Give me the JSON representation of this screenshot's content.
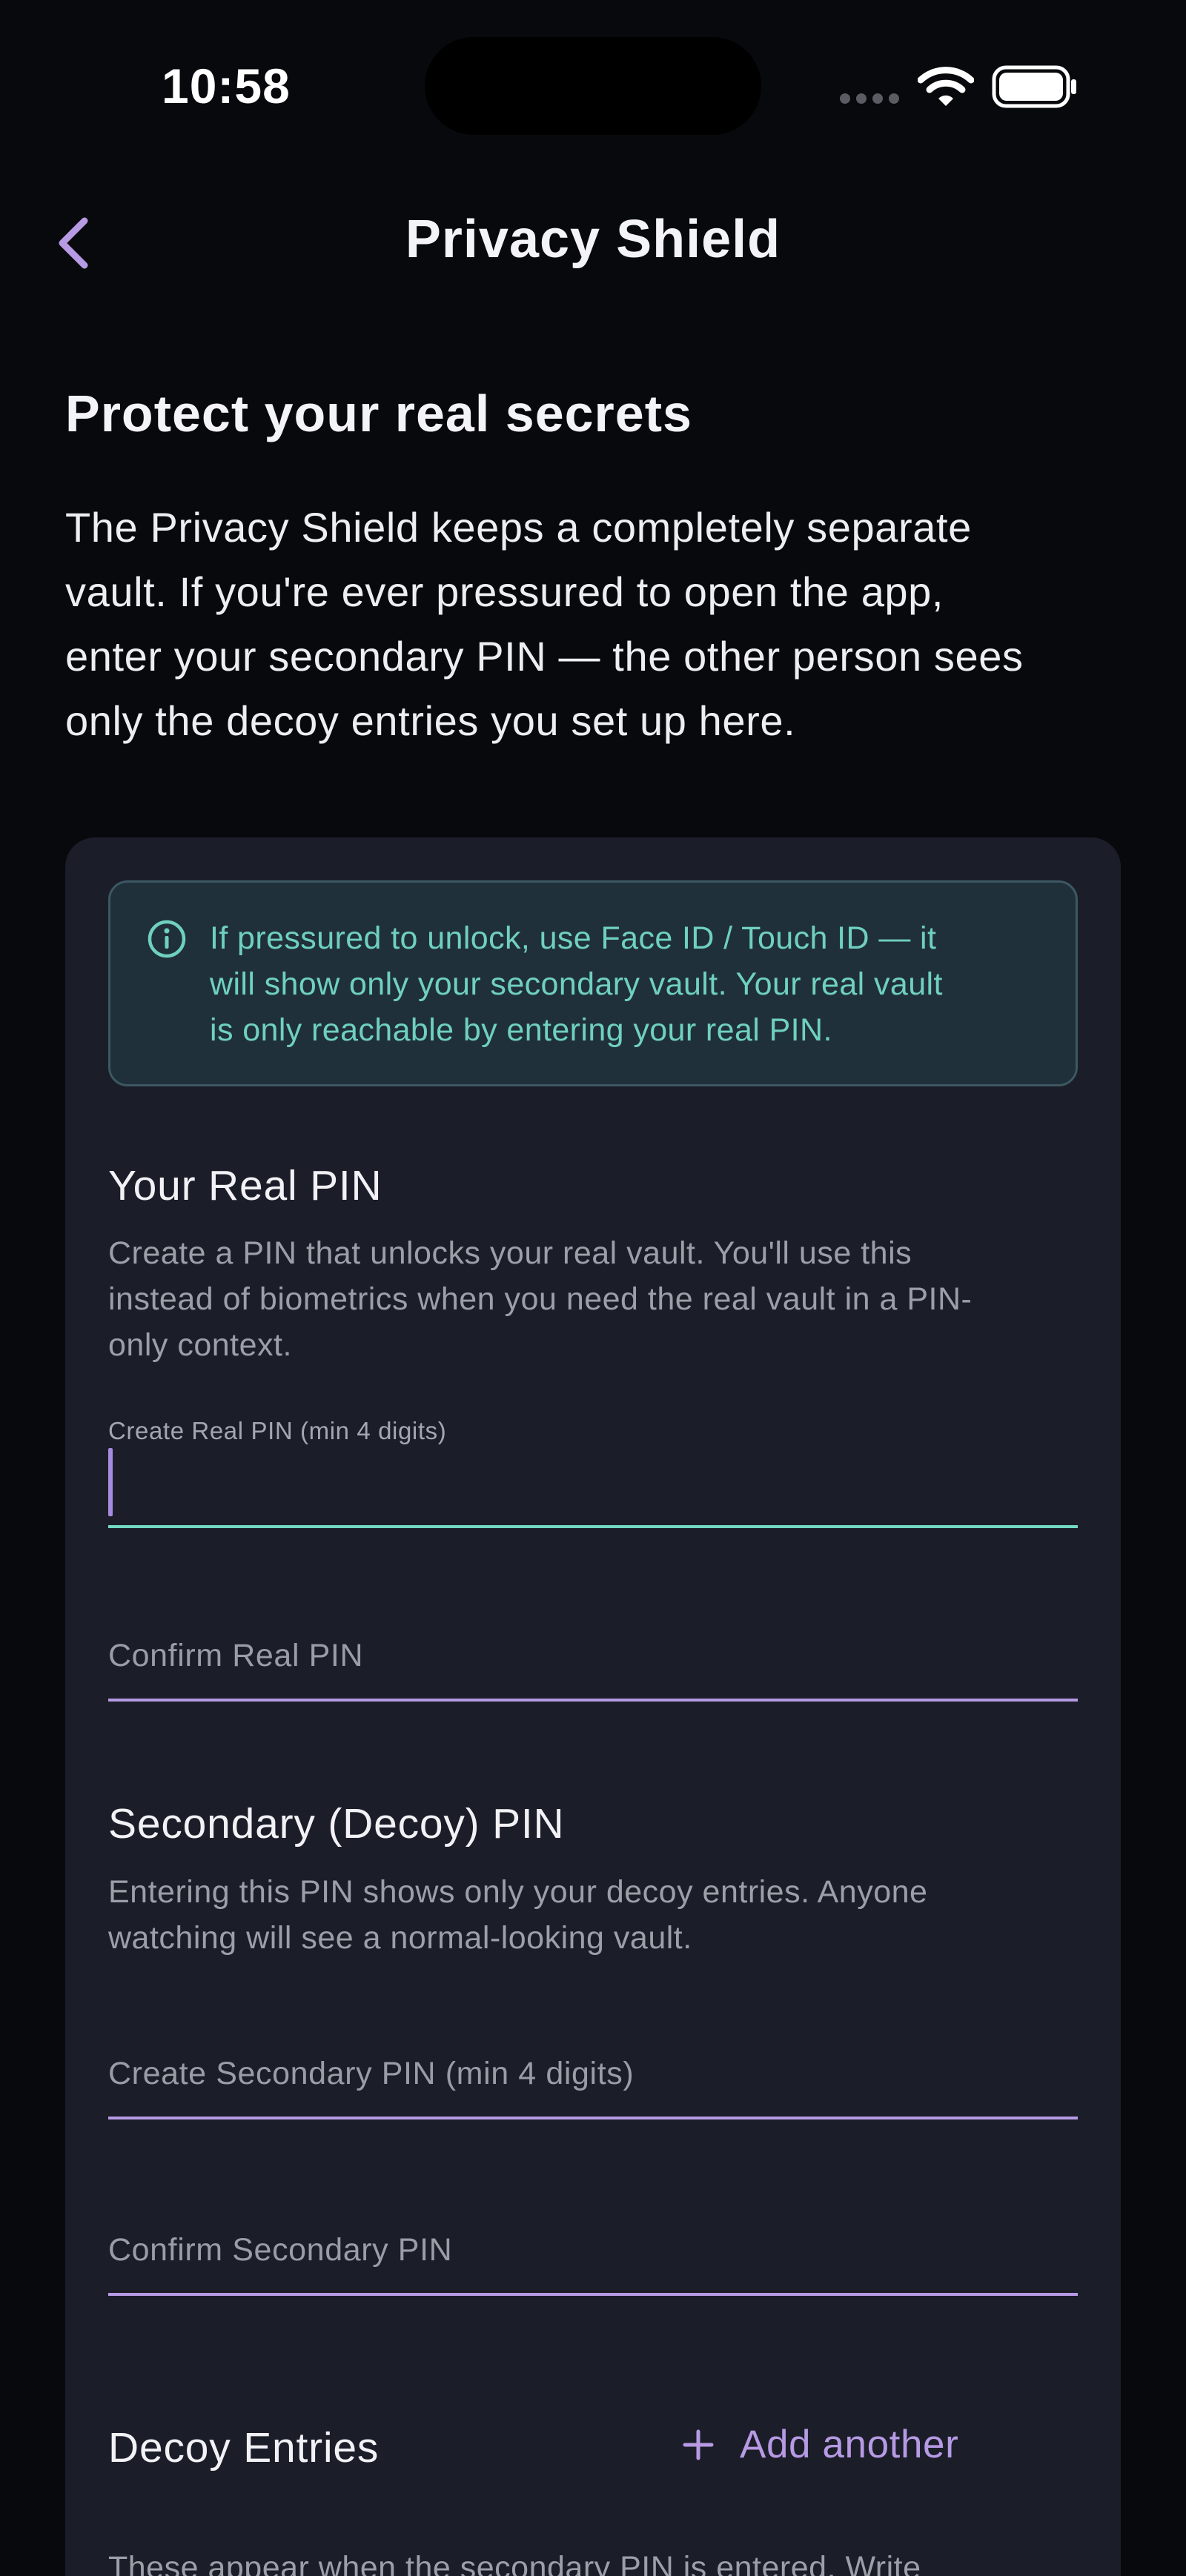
{
  "status_bar": {
    "time": "10:58"
  },
  "nav": {
    "title": "Privacy Shield",
    "back_icon": "chevron-left-icon"
  },
  "intro": {
    "heading": "Protect your real secrets",
    "lines": [
      "The Privacy Shield keeps a completely separate",
      "vault. If you're ever pressured to open the app,",
      "enter your secondary PIN — the other person sees",
      "only the decoy entries you set up here."
    ]
  },
  "info_banner": {
    "icon": "info-circle-icon",
    "lines": [
      "If pressured to unlock, use Face ID / Touch ID — it",
      "will show only your secondary vault. Your real vault",
      "is only reachable by entering your real PIN."
    ]
  },
  "real_pin": {
    "title": "Your Real PIN",
    "desc_lines": [
      "Create a PIN that unlocks your real vault. You'll use this",
      "instead of biometrics when you need the real vault in a PIN-",
      "only context."
    ],
    "create_label": "Create Real PIN (min 4 digits)",
    "create_value": "",
    "confirm_placeholder": "Confirm Real PIN"
  },
  "secondary_pin": {
    "title": "Secondary (Decoy) PIN",
    "desc_lines": [
      "Entering this PIN shows only your decoy entries. Anyone",
      "watching will see a normal-looking vault."
    ],
    "create_placeholder": "Create Secondary PIN (min 4 digits)",
    "confirm_placeholder": "Confirm Secondary PIN"
  },
  "decoy_entries": {
    "title": "Decoy Entries",
    "add_label": "Add another",
    "add_icon": "plus-icon",
    "desc_line": "These appear when the secondary PIN is entered. Write"
  },
  "colors": {
    "background": "#08090d",
    "card": "#1b1e29",
    "accent_purple": "#b79ae4",
    "accent_teal": "#72d9c3",
    "info_text": "#6fd1bd"
  }
}
